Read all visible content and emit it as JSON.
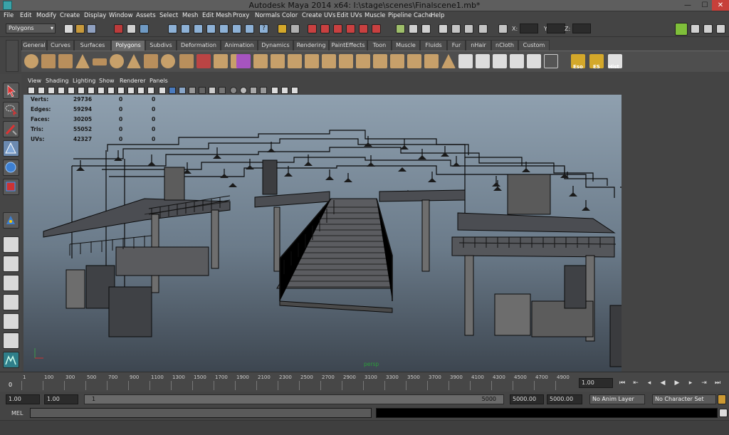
{
  "window": {
    "title": "Autodesk Maya 2014 x64: I:\\stage\\scenes\\Finalscene1.mb*",
    "minimize": "—",
    "maximize": "☐",
    "close": "✕"
  },
  "menu": [
    "File",
    "Edit",
    "Modify",
    "Create",
    "Display",
    "Window",
    "Assets",
    "Select",
    "Mesh",
    "Edit Mesh",
    "Proxy",
    "Normals",
    "Color",
    "Create UVs",
    "Edit UVs",
    "Muscle",
    "Pipeline Cache",
    "Help"
  ],
  "status": {
    "mode": "Polygons",
    "x_label": "X:",
    "y_label": "Y:",
    "z_label": "Z:"
  },
  "shelf_tabs": [
    "General",
    "Curves",
    "Surfaces",
    "Polygons",
    "Subdivs",
    "Deformation",
    "Animation",
    "Dynamics",
    "Rendering",
    "PaintEffects",
    "Toon",
    "Muscle",
    "Fluids",
    "Fur",
    "nHair",
    "nCloth",
    "Custom"
  ],
  "active_shelf_tab": "Polygons",
  "shelf_labels": {
    "eso": "Eso",
    "es": "ES",
    "hist": "Hist"
  },
  "panel_menu": [
    "View",
    "Shading",
    "Lighting",
    "Show",
    "Renderer",
    "Panels"
  ],
  "hud": {
    "rows": [
      {
        "label": "Verts:",
        "a": "29736",
        "b": "0",
        "c": "0"
      },
      {
        "label": "Edges:",
        "a": "59294",
        "b": "0",
        "c": "0"
      },
      {
        "label": "Faces:",
        "a": "30205",
        "b": "0",
        "c": "0"
      },
      {
        "label": "Tris:",
        "a": "55052",
        "b": "0",
        "c": "0"
      },
      {
        "label": "UVs:",
        "a": "42327",
        "b": "0",
        "c": "0"
      }
    ],
    "camera": "persp"
  },
  "timeline": {
    "ticks": [
      "1",
      "100",
      "300",
      "500",
      "700",
      "900",
      "1100",
      "1300",
      "1500",
      "1700",
      "1900",
      "2100",
      "2300",
      "2500",
      "2700",
      "2900",
      "3100",
      "3300",
      "3500",
      "3700",
      "3900",
      "4100",
      "4300",
      "4500",
      "4700",
      "4900"
    ],
    "current_frame": "0",
    "current_field": "1.00"
  },
  "range": {
    "start": "1.00",
    "start2": "1.00",
    "slider_start": "1",
    "slider_end": "5000",
    "end1": "5000.00",
    "end2": "5000.00",
    "anim_layer": "No Anim Layer",
    "char_set": "No Character Set"
  },
  "cmd": {
    "label": "MEL"
  },
  "colors": {
    "accent_green": "#2b9f3a",
    "viewport_top": "#8fa0af",
    "viewport_bottom": "#3d4650"
  }
}
